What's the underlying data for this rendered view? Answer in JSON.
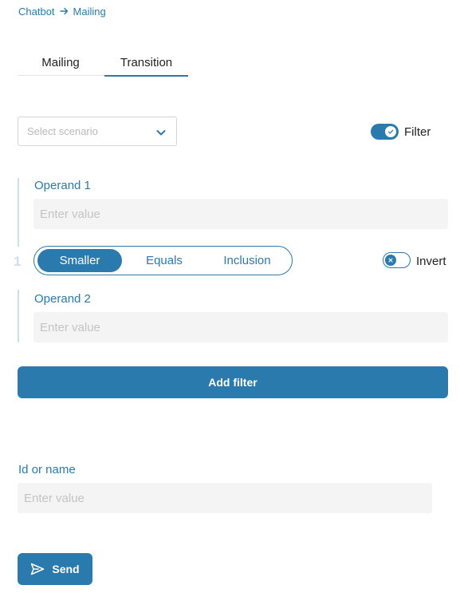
{
  "breadcrumb": {
    "items": [
      "Chatbot",
      "Mailing"
    ],
    "separator_icon": "arrow-right-icon"
  },
  "tabs": [
    {
      "label": "Mailing",
      "active": false
    },
    {
      "label": "Transition",
      "active": true
    }
  ],
  "scenario_select": {
    "placeholder": "Select scenario",
    "icon": "chevron-down-icon"
  },
  "filter_toggle": {
    "label": "Filter",
    "on": true
  },
  "filter_group": {
    "index": "1",
    "operand1": {
      "label": "Operand 1",
      "placeholder": "Enter value",
      "value": ""
    },
    "operators": [
      {
        "label": "Smaller",
        "active": true
      },
      {
        "label": "Equals",
        "active": false
      },
      {
        "label": "Inclusion",
        "active": false
      }
    ],
    "invert_toggle": {
      "label": "Invert",
      "on": false
    },
    "operand2": {
      "label": "Operand 2",
      "placeholder": "Enter value",
      "value": ""
    }
  },
  "add_filter_label": "Add filter",
  "id_field": {
    "label": "Id or name",
    "placeholder": "Enter value",
    "value": ""
  },
  "send_button": {
    "label": "Send",
    "icon": "send-icon"
  },
  "colors": {
    "accent": "#2a7aad",
    "input_bg": "#f4f4f4",
    "group_bar": "#cfe0ec"
  }
}
